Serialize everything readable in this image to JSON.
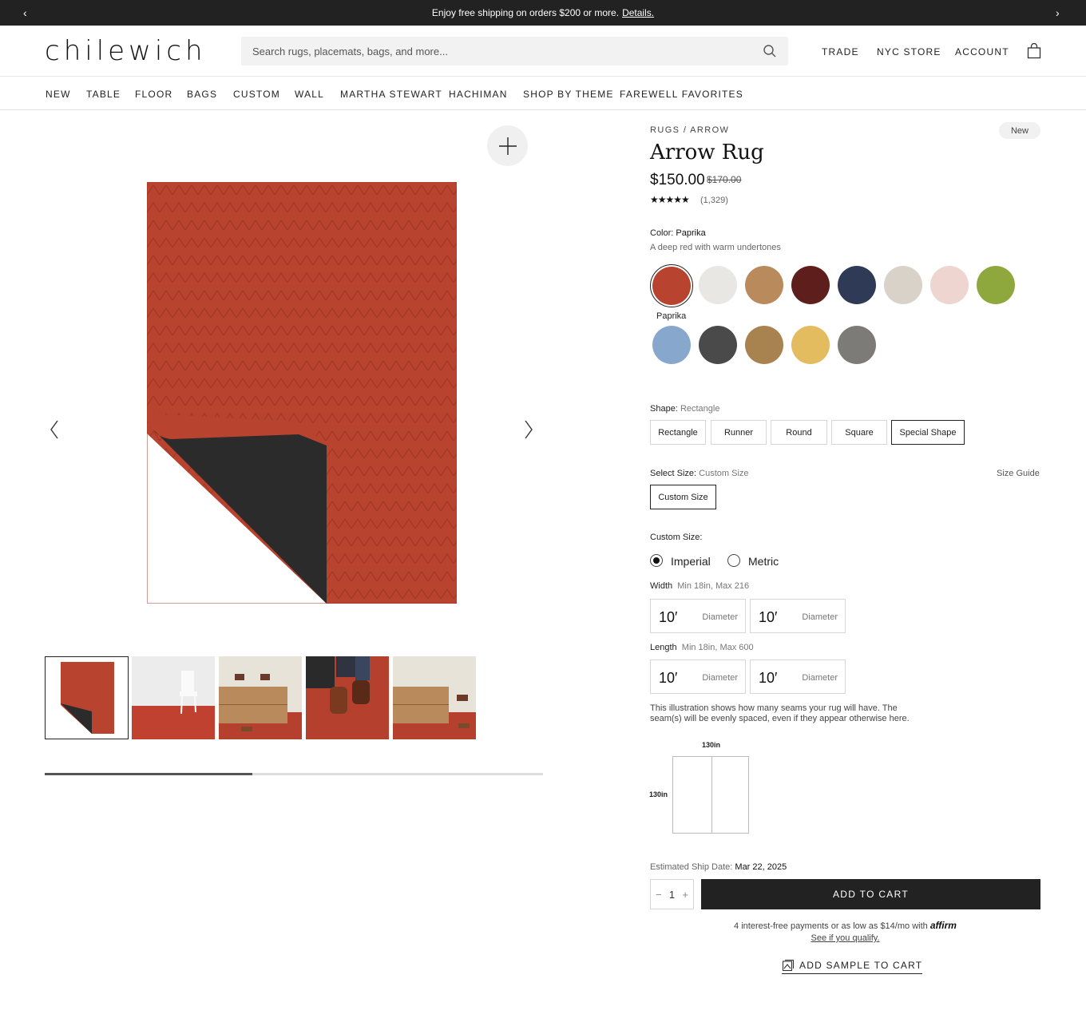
{
  "promo": {
    "text": "Enjoy free shipping on orders $200 or more.",
    "link": "Details."
  },
  "header": {
    "logo": "chilewich",
    "search_placeholder": "Search rugs, placemats, bags, and more...",
    "links": [
      "TRADE",
      "NYC STORE",
      "ACCOUNT"
    ]
  },
  "nav": [
    "NEW",
    "TABLE",
    "FLOOR",
    "BAGS",
    "CUSTOM",
    "WALL",
    "MARTHA STEWART",
    "HACHIMAN",
    "SHOP BY THEME",
    "FAREWELL FAVORITES"
  ],
  "product": {
    "breadcrumb": "RUGS / ARROW",
    "badge": "New",
    "title": "Arrow Rug",
    "price": "$150.00",
    "old_price": "$170.00",
    "stars": "★★★★★",
    "rating_count": "(1,329)",
    "color_label": "Color:",
    "color_value": "Paprika",
    "color_desc": "A deep red with warm undertones",
    "selected_swatch_label": "Paprika",
    "swatch_colors": [
      "#b8432e",
      "#e9e7e3",
      "#b98a5b",
      "#5e1f1c",
      "#2e3a56",
      "#d8d2c8",
      "#eed5cf",
      "#8fa83e",
      "#87a7cc",
      "#4a4a4a",
      "#a8824f",
      "#e3bc5f",
      "#7c7b78"
    ],
    "shape_label": "Shape:",
    "shape_value": "Rectangle",
    "shapes": [
      "Rectangle",
      "Runner",
      "Round",
      "Square",
      "Special Shape"
    ],
    "size_label": "Select Size:",
    "size_value": "Custom Size",
    "size_guide": "Size Guide",
    "size_option": "Custom Size",
    "custom_size_label": "Custom Size:",
    "units": [
      "Imperial",
      "Metric"
    ],
    "width_label": "Width",
    "width_range": "Min 18in, Max 216",
    "length_label": "Length",
    "length_range": "Min 18in, Max 600",
    "dim_value": "10′",
    "dim_unit": "Diameter",
    "seam_note": "This illustration shows how many seams your rug will have. The seam(s) will be evenly spaced, even if they appear otherwise here.",
    "seam_width": "130in",
    "seam_height": "130in",
    "ship_label": "Estimated Ship Date:",
    "ship_date": "Mar 22, 2025",
    "qty": "1",
    "add_to_cart": "ADD TO CART",
    "affirm_text": "4 interest-free payments or as low as $14/mo with",
    "affirm_brand": "affirm",
    "qualify": "See if you qualify.",
    "add_sample": "ADD SAMPLE TO CART"
  },
  "colors": {
    "accent": "#222222",
    "rug": "#b8432e",
    "backing": "#2b2b2b"
  }
}
